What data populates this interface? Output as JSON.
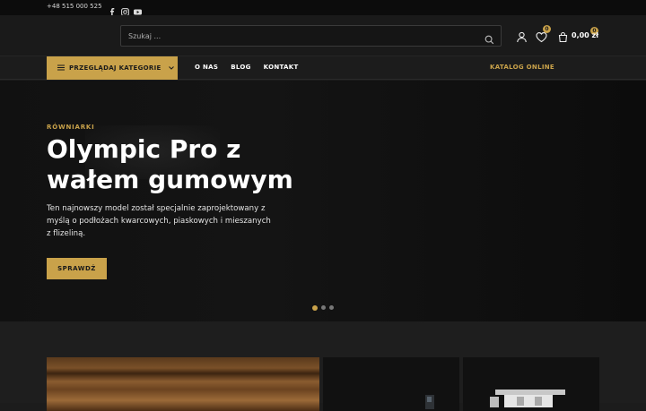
{
  "topbar": {
    "phone": "+48 515 000 525",
    "social": [
      "facebook-icon",
      "instagram-icon",
      "youtube-icon"
    ]
  },
  "header": {
    "search_placeholder": "Szukaj ...",
    "wishlist_count": "0",
    "cart_count": "0",
    "cart_total": "0,00 zł"
  },
  "nav": {
    "categories_label": "PRZEGLĄDAJ KATEGORIE",
    "links": [
      "O NAS",
      "BLOG",
      "KONTAKT"
    ],
    "catalog_label": "KATALOG ONLINE"
  },
  "hero": {
    "kicker": "RÓWNIARKI",
    "title": "Olympic Pro z wałem gumowym",
    "description": "Ten najnowszy model został specjalnie zaprojektowany z myślą o podłożach kwarcowych, piaskowych i mieszanych z flizeliną.",
    "cta_label": "SPRAWDŹ",
    "slides": 3,
    "active_slide": 1
  },
  "colors": {
    "accent": "#c9a24a",
    "background": "#1c1c1c",
    "hero_bg": "#111111"
  }
}
